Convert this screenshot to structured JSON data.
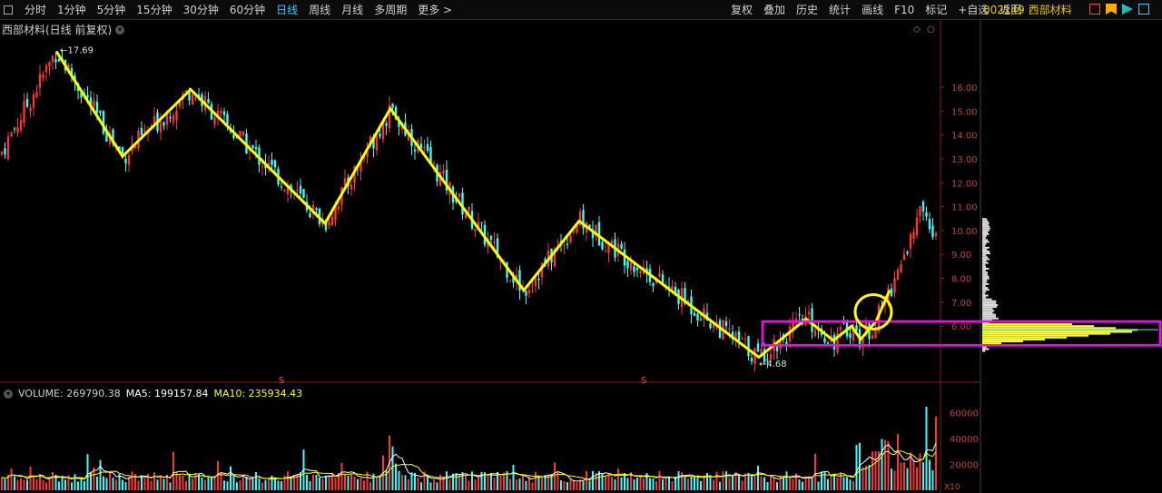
{
  "toolbar": {
    "periods": [
      "分时",
      "1分钟",
      "5分钟",
      "15分钟",
      "30分钟",
      "60分钟",
      "日线",
      "周线",
      "月线",
      "多周期",
      "更多 >"
    ],
    "active_period": "日线",
    "tools": [
      "复权",
      "叠加",
      "历史",
      "统计",
      "画线",
      "F10",
      "标记",
      "+自选",
      "返回"
    ],
    "stock_code": "002149 西部材料"
  },
  "chart_title": "西部材料(日线 前复权)",
  "price_chart": {
    "max_label": "17.69",
    "min_label": "4.68",
    "dividend_marker": "S",
    "y_ticks": [
      "16.00",
      "15.00",
      "14.00",
      "13.00",
      "12.00",
      "11.00",
      "10.00",
      "9.00",
      "8.00",
      "7.00",
      "6.00"
    ]
  },
  "volume_panel": {
    "volume_label": "VOLUME: 269790.38",
    "ma5_label": "MA5: 199157.84",
    "ma10_label": "MA10: 235934.43",
    "y_ticks": [
      "60000",
      "40000",
      "20000"
    ],
    "unit": "X10"
  },
  "colors": {
    "up": "#ff3333",
    "down": "#33ffff",
    "trend_line": "#ffff00",
    "box": "#ff00ff",
    "ma5": "#ffffff",
    "ma10": "#ffff00",
    "accent": "#33ccff"
  },
  "chart_data": {
    "type": "candlestick",
    "y_axis_range": [
      4.3,
      18.2
    ],
    "price_extremes": {
      "high": 17.69,
      "low": 4.68
    },
    "zigzag_points": [
      {
        "y": 17.5
      },
      {
        "y": 13.1
      },
      {
        "y": 15.9
      },
      {
        "y": 10.3
      },
      {
        "y": 15.1
      },
      {
        "y": 7.5
      },
      {
        "y": 10.4
      },
      {
        "y": 4.7
      },
      {
        "y": 6.3
      },
      {
        "y": 5.4
      },
      {
        "y": 6.0
      },
      {
        "y": 5.45
      },
      {
        "y": 6.2
      },
      {
        "y": 7.5
      }
    ],
    "consolidation_box": {
      "price_low": 5.2,
      "price_high": 6.2
    },
    "volume_axis_max": 70000
  }
}
